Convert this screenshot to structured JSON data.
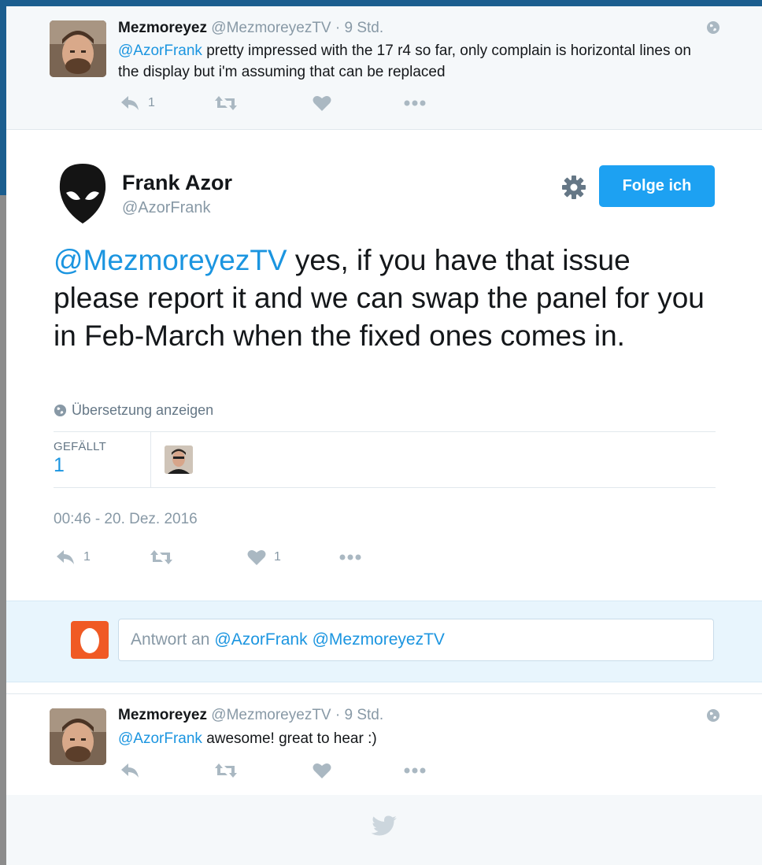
{
  "ancestor_tweet": {
    "name": "Mezmoreyez",
    "handle": "@MezmoreyezTV",
    "separator": "·",
    "time": "9 Std.",
    "mention": "@AzorFrank",
    "text": "pretty impressed with the 17 r4 so far, only complain is horizontal lines on the display but i'm assuming that can be replaced",
    "reply_count": "1"
  },
  "main_tweet": {
    "name": "Frank Azor",
    "handle": "@AzorFrank",
    "follow_label": "Folge ich",
    "mention": "@MezmoreyezTV",
    "text": "yes, if you have that issue please report it and we can swap the panel for you in Feb-March when the fixed ones comes in.",
    "translate_label": "Übersetzung anzeigen",
    "likes_label": "GEFÄLLT",
    "likes_value": "1",
    "timestamp": "00:46 - 20. Dez. 2016",
    "reply_count": "1",
    "like_count": "1"
  },
  "reply_box": {
    "prefix": "Antwort an",
    "mention1": "@AzorFrank",
    "mention2": "@MezmoreyezTV"
  },
  "descendant_tweet": {
    "name": "Mezmoreyez",
    "handle": "@MezmoreyezTV",
    "separator": "·",
    "time": "9 Std.",
    "mention": "@AzorFrank",
    "text": "awesome! great to hear :)"
  },
  "colors": {
    "accent": "#1da1f2",
    "link": "#1b95e0",
    "muted": "#8899a6",
    "egg_avatar": "#f05a24"
  },
  "icons": [
    "globe-icon",
    "reply-icon",
    "retweet-icon",
    "heart-icon",
    "more-icon",
    "gear-icon",
    "twitter-bird-icon",
    "egg-avatar"
  ]
}
